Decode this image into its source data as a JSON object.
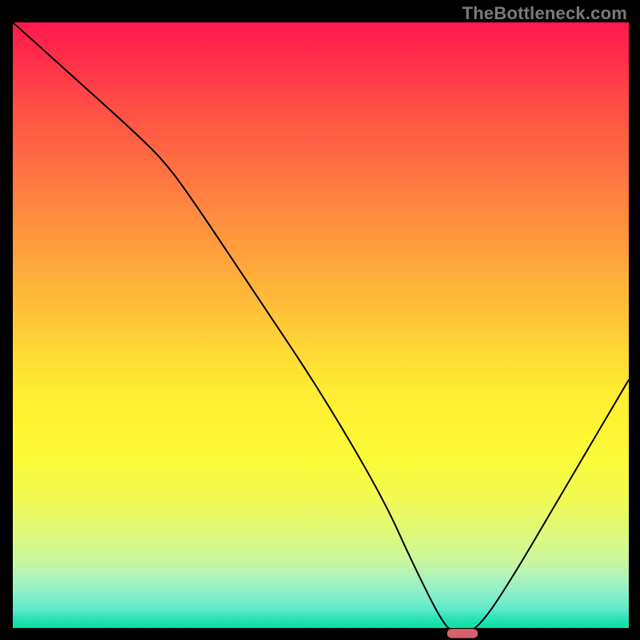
{
  "watermark": "TheBottleneck.com",
  "chart_data": {
    "type": "line",
    "title": "",
    "xlabel": "",
    "ylabel": "",
    "xlim": [
      0,
      100
    ],
    "ylim": [
      0,
      100
    ],
    "series": [
      {
        "name": "bottleneck-curve",
        "x": [
          0,
          10,
          20,
          25,
          30,
          40,
          50,
          60,
          65,
          70,
          72,
          75,
          80,
          90,
          100
        ],
        "y": [
          100,
          91,
          82,
          77,
          70,
          55,
          40,
          23,
          12,
          2,
          1,
          1,
          8,
          25,
          42
        ]
      }
    ],
    "marker": {
      "name": "optimal-point",
      "x": 73,
      "y": 0.8,
      "width": 5,
      "height": 1.5,
      "color": "#d6626b"
    },
    "background": {
      "type": "vertical-gradient",
      "stops": [
        {
          "pos": 0,
          "color": "#ff1a4d"
        },
        {
          "pos": 0.3,
          "color": "#ff8540"
        },
        {
          "pos": 0.6,
          "color": "#ffea33"
        },
        {
          "pos": 0.85,
          "color": "#d9f885"
        },
        {
          "pos": 1.0,
          "color": "#0ae0a0"
        }
      ]
    }
  }
}
